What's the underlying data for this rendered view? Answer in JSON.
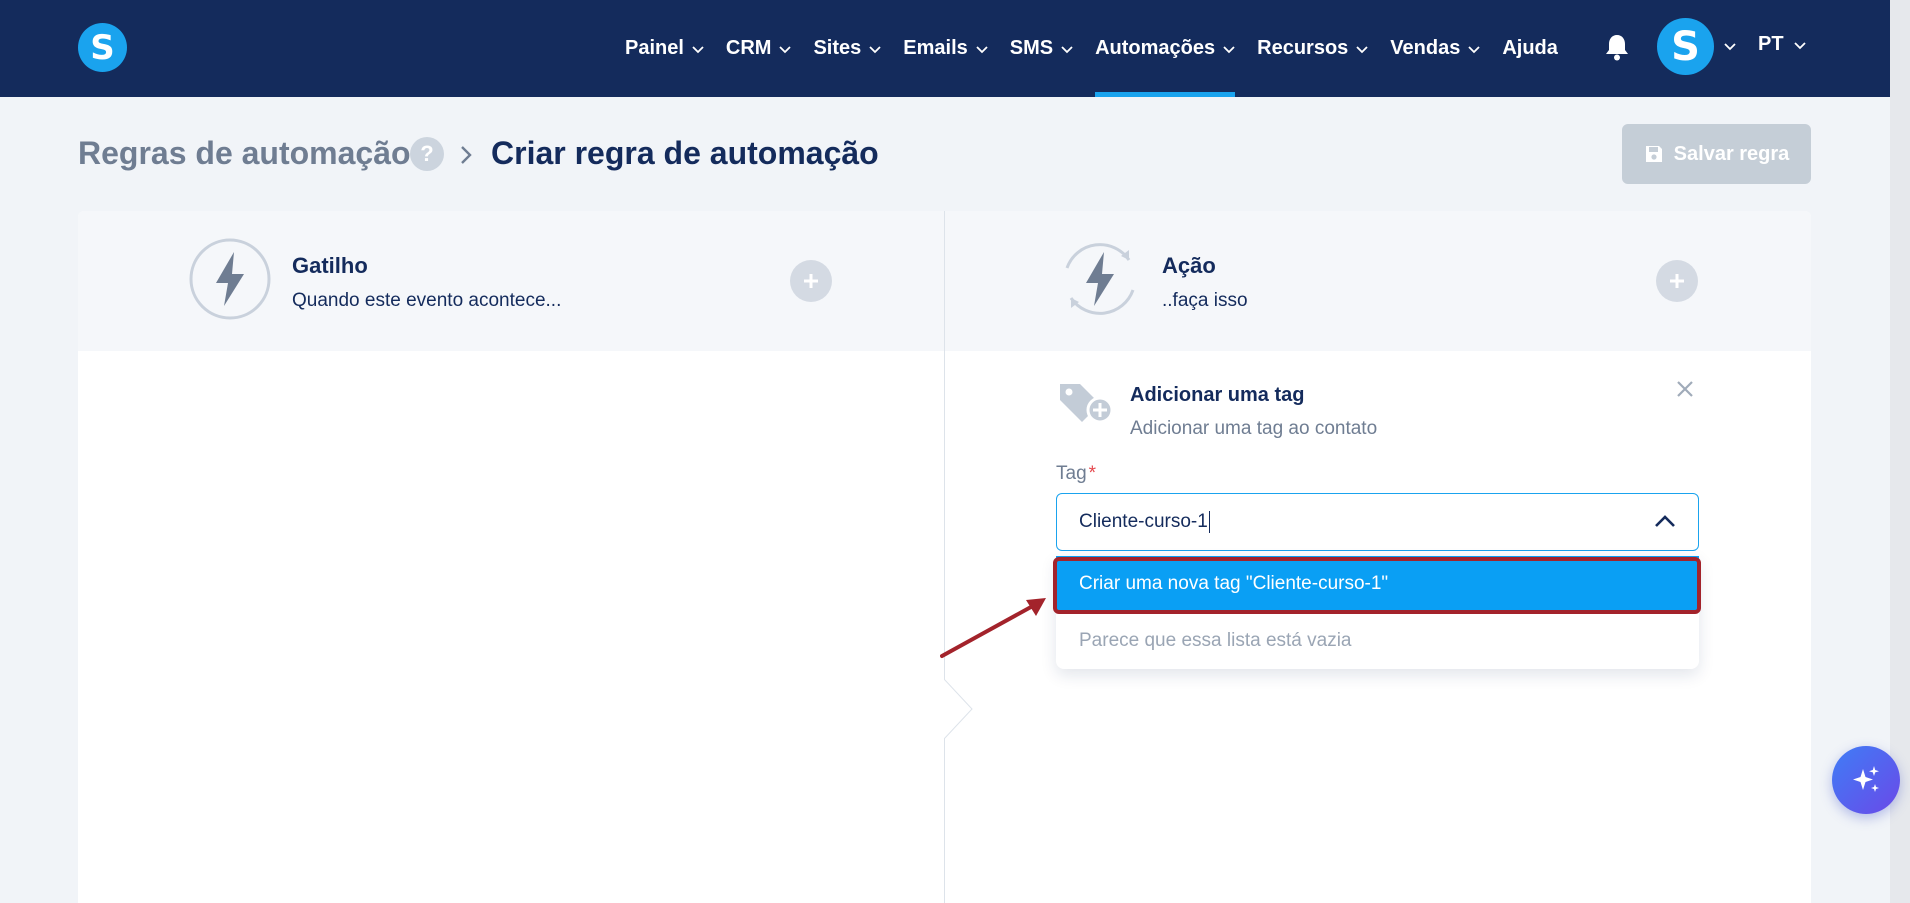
{
  "brand": {
    "logo_letter": "S"
  },
  "nav": {
    "items": [
      {
        "label": "Painel",
        "has_menu": true
      },
      {
        "label": "CRM",
        "has_menu": true
      },
      {
        "label": "Sites",
        "has_menu": true
      },
      {
        "label": "Emails",
        "has_menu": true
      },
      {
        "label": "SMS",
        "has_menu": true
      },
      {
        "label": "Automações",
        "has_menu": true,
        "active": true
      },
      {
        "label": "Recursos",
        "has_menu": true
      },
      {
        "label": "Vendas",
        "has_menu": true
      },
      {
        "label": "Ajuda",
        "has_menu": false
      }
    ],
    "avatar_letter": "S",
    "language": "PT"
  },
  "breadcrumb": {
    "root": "Regras de automação",
    "help": "?",
    "current": "Criar regra de automação"
  },
  "toolbar": {
    "save_label": "Salvar regra"
  },
  "trigger": {
    "title": "Gatilho",
    "subtitle": "Quando este evento acontece..."
  },
  "action": {
    "title": "Ação",
    "subtitle": "..faça isso"
  },
  "action_panel": {
    "title": "Adicionar uma tag",
    "subtitle": "Adicionar uma tag ao contato",
    "field_label": "Tag",
    "required_mark": "*",
    "input_value": "Cliente-curso-1",
    "dropdown": {
      "create_option": "Criar uma nova tag \"Cliente-curso-1\"",
      "empty_message": "Parece que essa lista está vazia"
    }
  },
  "colors": {
    "nav_bg": "#142b5c",
    "accent": "#1aa3ee",
    "highlight_border": "#a3232b",
    "option_bg": "#0a9ff4"
  }
}
